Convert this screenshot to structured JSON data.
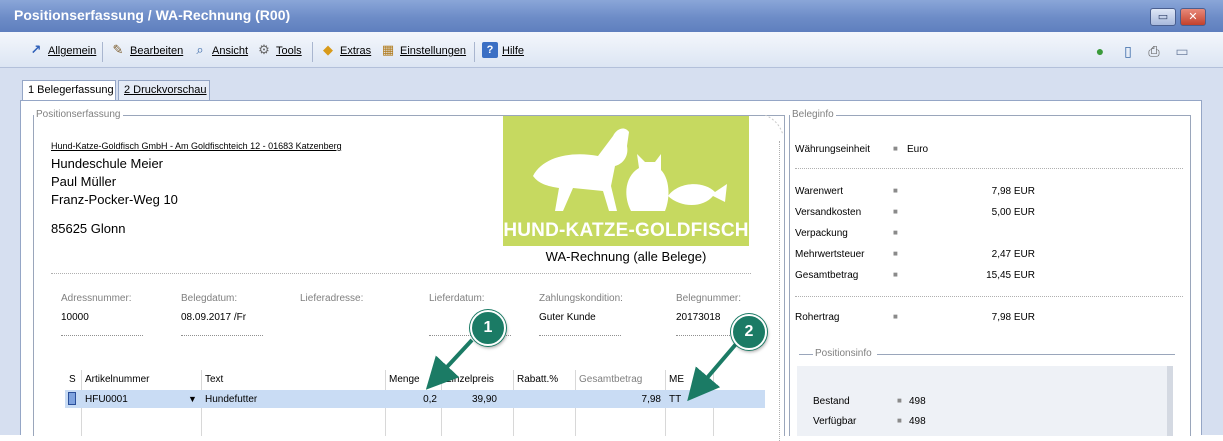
{
  "window": {
    "title": "Positionserfassung / WA-Rechnung (R00)",
    "buttons": {
      "minimize_glyph": "▭",
      "close_glyph": "✕"
    }
  },
  "menu": {
    "items": [
      {
        "label": "Allgemein",
        "icon": "arrow-icon"
      },
      {
        "label": "Bearbeiten",
        "icon": "edit-icon"
      },
      {
        "label": "Ansicht",
        "icon": "magnifier-icon"
      },
      {
        "label": "Tools",
        "icon": "tools-icon"
      },
      {
        "label": "Extras",
        "icon": "extras-icon"
      },
      {
        "label": "Einstellungen",
        "icon": "settings-icon"
      },
      {
        "label": "Hilfe",
        "icon": "help-icon"
      }
    ],
    "right_icons": [
      "globe-icon",
      "info-document-icon",
      "printer-icon",
      "window-icon"
    ]
  },
  "tabs": [
    {
      "label": "1 Belegerfassung",
      "active": true
    },
    {
      "label": "2 Druckvorschau",
      "active": false
    }
  ],
  "positionserfassung": {
    "legend": "Positionserfassung",
    "sender": "Hund-Katze-Goldfisch GmbH - Am Goldfischteich 12 - 01683 Katzenberg",
    "recipient": [
      "Hundeschule Meier",
      "Paul Müller",
      "Franz-Pocker-Weg 10",
      "85625 Glonn"
    ],
    "logo_text": "HUND-KATZE-GOLDFISCH",
    "document_type": "WA-Rechnung (alle Belege)",
    "fields": [
      {
        "label": "Adressnummer:",
        "value": "10000"
      },
      {
        "label": "Belegdatum:",
        "value": "08.09.2017 /Fr"
      },
      {
        "label": "Lieferadresse:",
        "value": ""
      },
      {
        "label": "Lieferdatum:",
        "value": ""
      },
      {
        "label": "Zahlungskondition:",
        "value": "Guter Kunde"
      },
      {
        "label": "Belegnummer:",
        "value": "20173018"
      }
    ],
    "table": {
      "headers": [
        "S",
        "Artikelnummer",
        "Text",
        "Menge",
        "Einzelpreis",
        "Rabatt.%",
        "Gesamtbetrag",
        "ME"
      ],
      "rows": [
        {
          "s": "",
          "artikelnummer": "HFU0001",
          "text": "Hundefutter",
          "menge": "0,2",
          "einzelpreis": "39,90",
          "rabatt": "",
          "gesamtbetrag": "7,98",
          "me": "TT"
        }
      ]
    }
  },
  "beleginfo": {
    "legend": "Beleginfo",
    "waehrung_label": "Währungseinheit",
    "waehrung_value": "Euro",
    "rows": [
      {
        "label": "Warenwert",
        "value": "7,98 EUR"
      },
      {
        "label": "Versandkosten",
        "value": "5,00 EUR"
      },
      {
        "label": "Verpackung",
        "value": ""
      },
      {
        "label": "Mehrwertsteuer",
        "value": "2,47 EUR"
      },
      {
        "label": "Gesamtbetrag",
        "value": "15,45 EUR"
      }
    ],
    "rohertrag_label": "Rohertrag",
    "rohertrag_value": "7,98 EUR"
  },
  "positionsinfo": {
    "legend": "Positionsinfo",
    "rows": [
      {
        "label": "Bestand",
        "value": "498"
      },
      {
        "label": "Verfügbar",
        "value": "498"
      }
    ]
  },
  "callouts": [
    "1",
    "2"
  ],
  "colors": {
    "accent": "#1b7b65",
    "logo_bg": "#c6d960",
    "selection": "#c9dcf4",
    "titlebar": "#6d8cc7"
  }
}
